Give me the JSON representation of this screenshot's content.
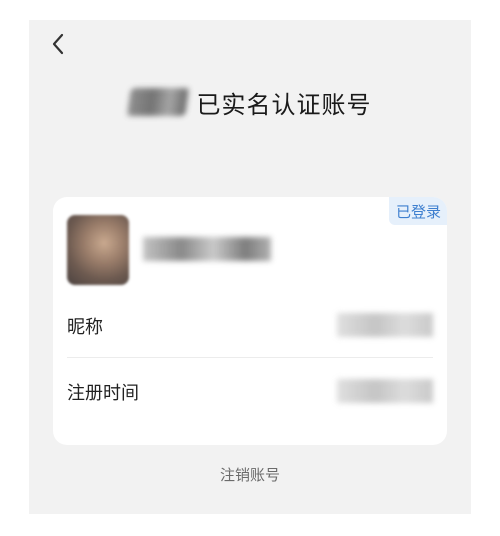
{
  "header": {
    "back_icon": "chevron-left-icon",
    "title": "已实名认证账号"
  },
  "account_card": {
    "status_badge": "已登录",
    "rows": [
      {
        "label": "昵称"
      },
      {
        "label": "注册时间"
      }
    ]
  },
  "footer": {
    "cancel_account_label": "注销账号"
  },
  "colors": {
    "page_background": "#f2f2f2",
    "card_background": "#ffffff",
    "badge_text": "#3e7fcf",
    "badge_background": "#e6f0fb"
  }
}
